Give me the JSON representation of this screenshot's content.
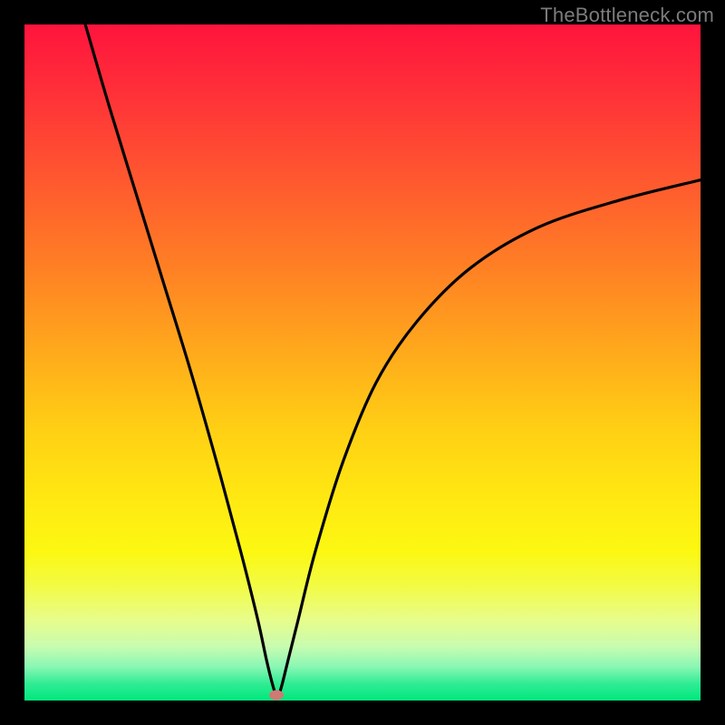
{
  "watermark": "TheBottleneck.com",
  "colors": {
    "gradient_top": "#ff143c",
    "gradient_mid": "#ffd014",
    "gradient_bottom": "#00e77d",
    "curve": "#000000",
    "marker": "#cf7a74",
    "frame": "#000000"
  },
  "chart_data": {
    "type": "line",
    "title": "",
    "xlabel": "",
    "ylabel": "",
    "xlim": [
      0,
      100
    ],
    "ylim": [
      0,
      100
    ],
    "notes": "V-shaped curve on a red-to-green vertical gradient. Minimum near x≈37 at y≈0. Left branch rises sharply; right branch rises with decreasing slope. Marker at the minimum.",
    "series": [
      {
        "name": "curve",
        "x": [
          9.0,
          12.5,
          16.5,
          20.5,
          24.5,
          28.5,
          32.0,
          34.5,
          35.8,
          36.8,
          37.4,
          38.0,
          39.0,
          40.5,
          43.0,
          47.0,
          52.0,
          58.0,
          66.0,
          76.0,
          88.0,
          100.0
        ],
        "y": [
          100.0,
          88.0,
          75.0,
          62.0,
          49.0,
          35.0,
          22.0,
          12.0,
          6.0,
          2.0,
          0.5,
          2.0,
          6.0,
          12.0,
          22.0,
          35.0,
          47.0,
          56.0,
          64.0,
          70.0,
          74.0,
          77.0
        ]
      }
    ],
    "marker": {
      "x": 37.2,
      "y": 0.8
    },
    "grid": false,
    "legend": false
  }
}
